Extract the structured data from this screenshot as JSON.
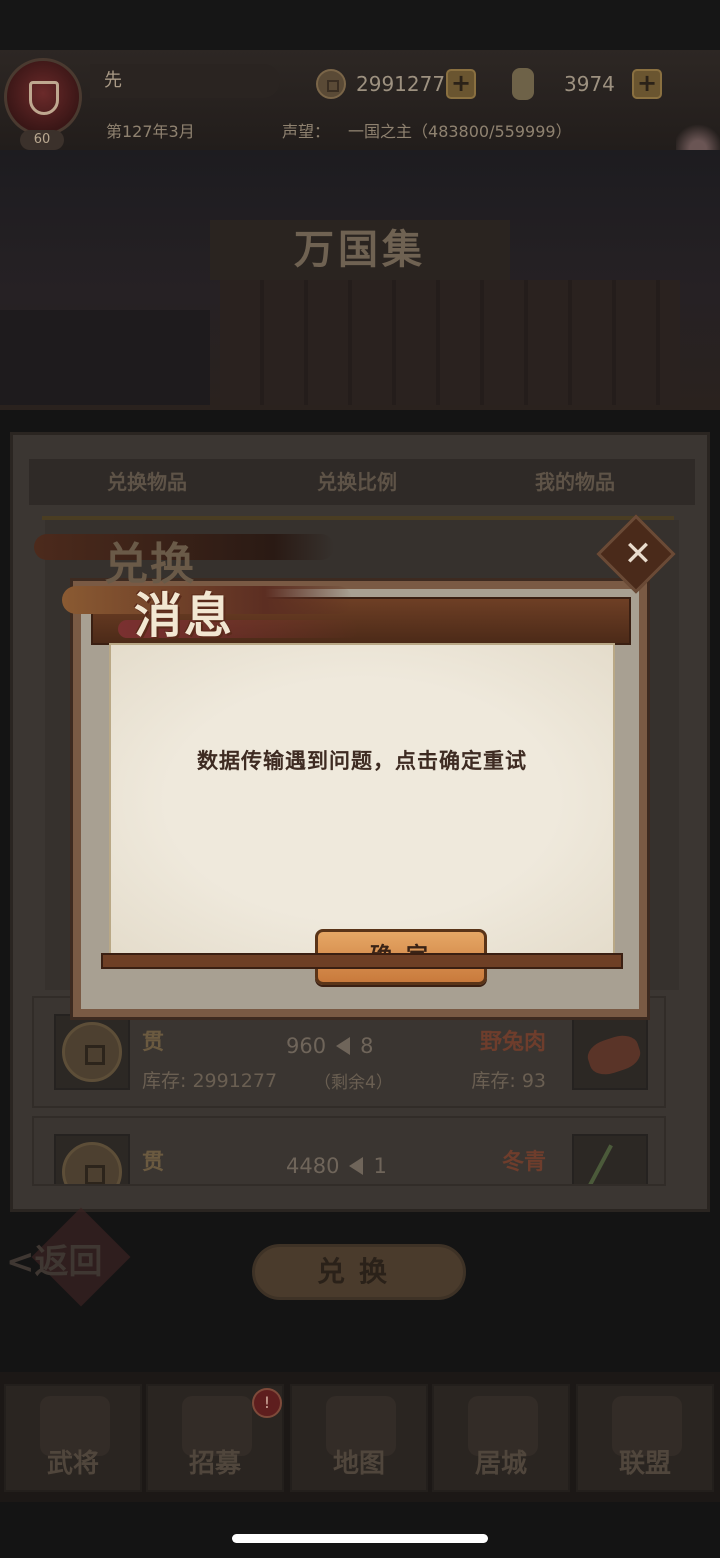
{
  "hud": {
    "player_name": "先",
    "level": "60",
    "date": "第127年3月",
    "prestige_label": "声望：",
    "prestige_value": "一国之主（483800/559999）",
    "coins": "2991277",
    "scrolls": "3974",
    "plus_label": "+"
  },
  "store": {
    "title": "万国集",
    "columns": [
      "兑换物品",
      "兑换比例",
      "我的物品"
    ]
  },
  "rows": [
    {
      "left_name": "贯",
      "left_stock": "库存: 2991277",
      "rate_left": "960",
      "rate_right": "8",
      "remain": "（剩余4）",
      "right_name": "野兔肉",
      "right_stock": "库存: 93"
    },
    {
      "left_name": "贯",
      "rate_left": "4480",
      "rate_right": "1",
      "right_name": "冬青"
    }
  ],
  "actions": {
    "back": "返回",
    "exchange": "兑换"
  },
  "nav": [
    {
      "label": "武将"
    },
    {
      "label": "招募",
      "badge": "!"
    },
    {
      "label": "地图"
    },
    {
      "label": "居城"
    },
    {
      "label": "联盟"
    }
  ],
  "modal": {
    "title_back": "兑换",
    "title": "消息",
    "message": "数据传输遇到问题，点击确定重试",
    "confirm": "确定",
    "close_symbol": "✕"
  },
  "colors": {
    "confirm_button": "#d98f4f",
    "paper": "#efe9dc",
    "frame_wood": "#6e3f25",
    "dim_overlay_bg": "#141414"
  }
}
